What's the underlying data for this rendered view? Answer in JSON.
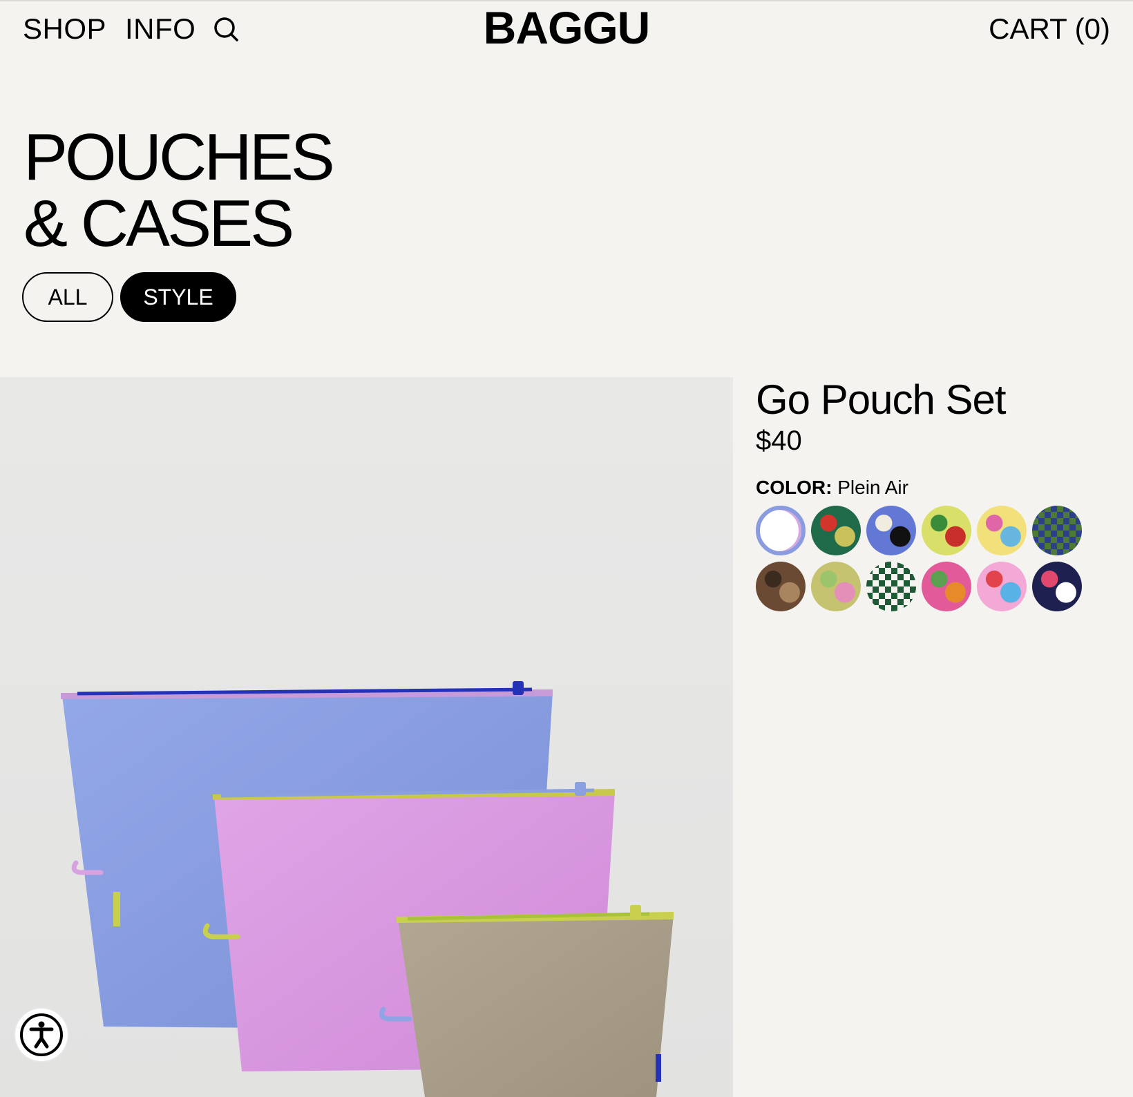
{
  "nav": {
    "shop": "SHOP",
    "info": "INFO",
    "search_icon": "search-icon",
    "logo": "BAGGU",
    "cart": "CART (0)"
  },
  "page": {
    "title_line1": "POUCHES",
    "title_line2": "& CASES"
  },
  "filters": [
    {
      "label": "ALL",
      "active": false
    },
    {
      "label": "STYLE",
      "active": true
    }
  ],
  "product": {
    "name": "Go Pouch Set",
    "price": "$40",
    "color_label": "COLOR:",
    "color_value": "Plein Air",
    "swatches": [
      {
        "selected": true,
        "colors": [
          "#8a9be0",
          "#d7a8e0"
        ]
      },
      {
        "selected": false,
        "colors": [
          "#1f6b49",
          "#c9c25a",
          "#d3342b"
        ]
      },
      {
        "selected": false,
        "colors": [
          "#6278d4",
          "#111111",
          "#f0ece0"
        ]
      },
      {
        "selected": false,
        "colors": [
          "#d9e06a",
          "#c92f2a",
          "#3a8c3a"
        ]
      },
      {
        "selected": false,
        "colors": [
          "#f2e07a",
          "#67b6e0",
          "#e067a7"
        ]
      },
      {
        "selected": false,
        "colors": [
          "#2d3f8a",
          "#4d7a36"
        ]
      },
      {
        "selected": false,
        "colors": [
          "#6b4a33",
          "#a8855f",
          "#3b2a1e"
        ]
      },
      {
        "selected": false,
        "colors": [
          "#c5c270",
          "#e48fb8",
          "#9cc46a"
        ]
      },
      {
        "selected": false,
        "colors": [
          "#1e5a35",
          "#f4f3ef"
        ]
      },
      {
        "selected": false,
        "colors": [
          "#e25a9a",
          "#e78a2a",
          "#5aa050"
        ]
      },
      {
        "selected": false,
        "colors": [
          "#f3a8d6",
          "#58b2e6",
          "#e0434c"
        ]
      },
      {
        "selected": false,
        "colors": [
          "#1e2150",
          "#ffffff",
          "#e0486e"
        ]
      }
    ]
  },
  "accessibility": {
    "icon": "accessibility-icon"
  }
}
